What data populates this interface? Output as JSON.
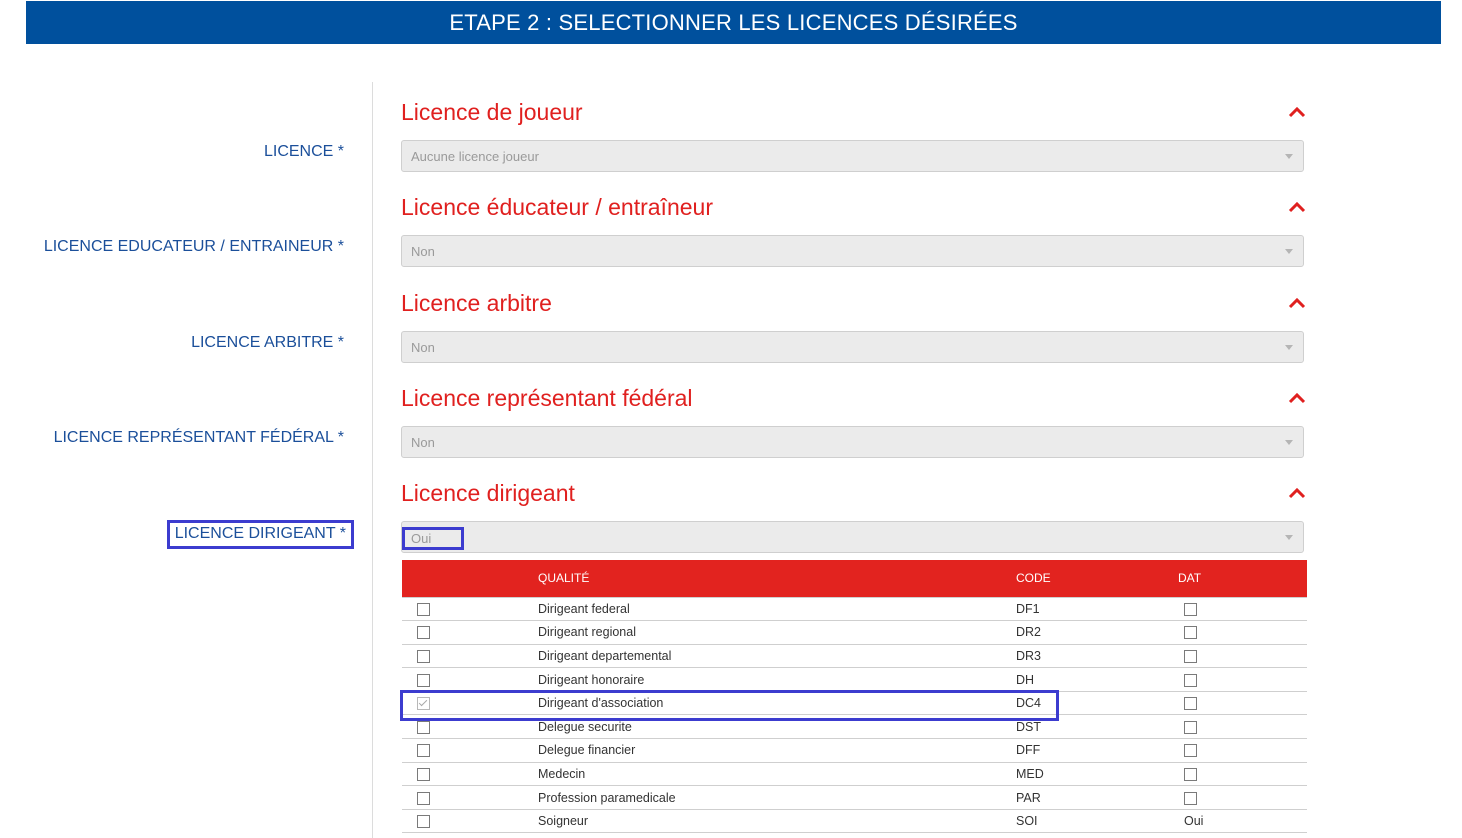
{
  "header": {
    "title": "ETAPE 2 : SELECTIONNER LES LICENCES DÉSIRÉES"
  },
  "sections": [
    {
      "title": "Licence de joueur",
      "label": "LICENCE *",
      "value": "Aucune licence joueur"
    },
    {
      "title": "Licence éducateur / entraîneur",
      "label": "LICENCE EDUCATEUR / ENTRAINEUR *",
      "value": "Non"
    },
    {
      "title": "Licence arbitre",
      "label": "LICENCE ARBITRE *",
      "value": "Non"
    },
    {
      "title": "Licence représentant fédéral",
      "label": "LICENCE REPRÉSENTANT FÉDÉRAL *",
      "value": "Non"
    },
    {
      "title": "Licence dirigeant",
      "label": "LICENCE DIRIGEANT *",
      "value": "Oui"
    }
  ],
  "table": {
    "headers": {
      "check": "",
      "qualite": "QUALITÉ",
      "code": "CODE",
      "dat": "DAT"
    },
    "rows": [
      {
        "qualite": "Dirigeant federal",
        "code": "DF1",
        "checked": false,
        "dat": ""
      },
      {
        "qualite": "Dirigeant regional",
        "code": "DR2",
        "checked": false,
        "dat": ""
      },
      {
        "qualite": "Dirigeant departemental",
        "code": "DR3",
        "checked": false,
        "dat": ""
      },
      {
        "qualite": "Dirigeant honoraire",
        "code": "DH",
        "checked": false,
        "dat": ""
      },
      {
        "qualite": "Dirigeant d'association",
        "code": "DC4",
        "checked": true,
        "dat": ""
      },
      {
        "qualite": "Delegue securite",
        "code": "DST",
        "checked": false,
        "dat": ""
      },
      {
        "qualite": "Delegue financier",
        "code": "DFF",
        "checked": false,
        "dat": ""
      },
      {
        "qualite": "Medecin",
        "code": "MED",
        "checked": false,
        "dat": ""
      },
      {
        "qualite": "Profession paramedicale",
        "code": "PAR",
        "checked": false,
        "dat": ""
      },
      {
        "qualite": "Soigneur",
        "code": "SOI",
        "checked": false,
        "dat": "Oui"
      }
    ]
  },
  "colors": {
    "banner": "#00509d",
    "accent_red": "#e0201f",
    "label_blue": "#1b4f9a",
    "highlight": "#3c3ccf"
  },
  "icons": {
    "collapse": "chevron-up-icon",
    "dropdown": "caret-down-icon"
  }
}
